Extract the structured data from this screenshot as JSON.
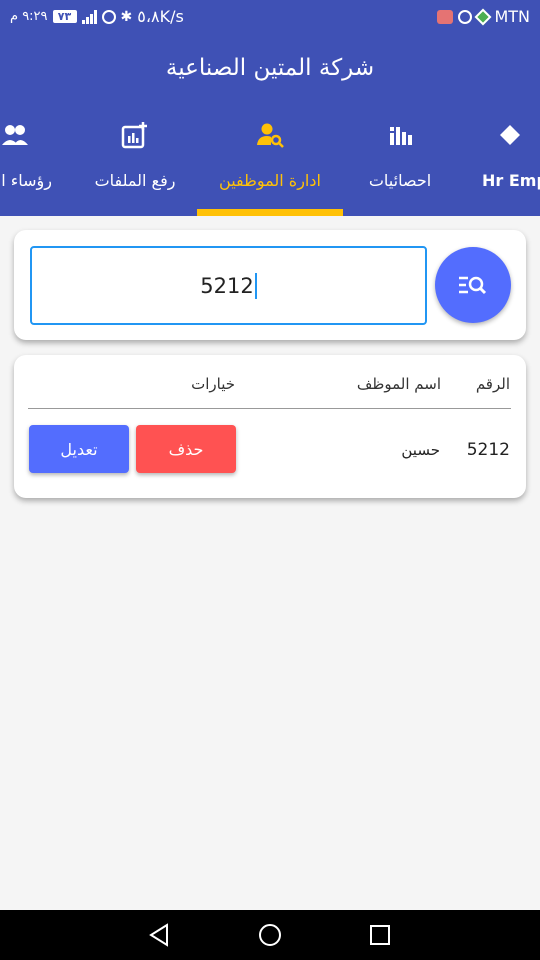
{
  "status_bar": {
    "carrier": "MTN",
    "speed": "٥،٨K/s",
    "battery": "٧٣",
    "time": "٩:٢٩ م"
  },
  "app": {
    "title": "شركة المتين الصناعية"
  },
  "tabs": [
    {
      "label": "رؤساء ا",
      "icon": "group-icon"
    },
    {
      "label": "رفع الملفات",
      "icon": "upload-chart-icon"
    },
    {
      "label": "ادارة الموظفين",
      "icon": "person-search-icon",
      "active": true
    },
    {
      "label": "احصائيات",
      "icon": "bar-chart-icon"
    },
    {
      "label": "Hr Emp",
      "icon": ""
    }
  ],
  "search": {
    "value": "5212",
    "button_icon": "search-list-icon"
  },
  "table": {
    "headers": {
      "id": "الرقم",
      "name": "اسم الموظف",
      "options": "خيارات"
    },
    "rows": [
      {
        "id": "5212",
        "name": "حسين",
        "delete_label": "حذف",
        "edit_label": "تعديل"
      }
    ]
  },
  "colors": {
    "primary": "#3f51b5",
    "accent": "#ffc107",
    "edit": "#536dfe",
    "delete": "#ff5252",
    "focus": "#2196f3"
  },
  "nav": [
    "back-icon",
    "home-icon",
    "recents-icon"
  ]
}
